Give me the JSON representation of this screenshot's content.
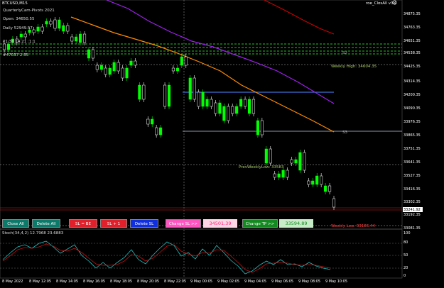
{
  "window": {
    "symbol_title": "BTCUSD,M15",
    "ea_label": "roe_ClosAll v3d",
    "smiley": "☺"
  },
  "info_panel": {
    "line1": "QuarterlyCam-Pivots 2021",
    "open": "Open: 34650.55",
    "line3": "Daily 52949.57",
    "line4": "P1:31 14:21 :1:1",
    "line5": "#47037 2:55"
  },
  "price_axis": {
    "ticks": [
      "34875.35",
      "34763.35",
      "34651.35",
      "34538.35",
      "34425.35",
      "34314.35",
      "34200.35",
      "34090.35",
      "33976.35",
      "33865.35",
      "33751.35",
      "33641.35",
      "33527.35",
      "33416.35",
      "33302.35",
      "33192.35",
      "33081.35"
    ],
    "current_price": "33241.92"
  },
  "level_labels": {
    "s2": "S2",
    "s3": "S3",
    "weekly_high": "Weekly High: 34604.35",
    "prev_weekly": "PrevWeeklyLow: 33583",
    "weekly_low": "Weekly Low: 33186.44"
  },
  "buttons": {
    "close_all": "Close All",
    "delete_all": "Delete All",
    "sl_be": "SL = BE",
    "sl_plus": "SL + 1",
    "delete_sl": "Delete SL",
    "change_sl": "Change SL >>",
    "sl_value": "34501.39",
    "change_tp": "Change TP >>",
    "tp_value": "33594.89"
  },
  "stoch": {
    "label": "Stoch(34,4,2) 12.7968 23.6883",
    "ticks": [
      "100",
      "80",
      "50",
      "20",
      "0"
    ]
  },
  "time_axis": [
    "8 May 2022",
    "8 May 12:05",
    "8 May 14:05",
    "8 May 16:05",
    "8 May 18:05",
    "8 May 20:05",
    "8 May 22:05",
    "9 May 00:05",
    "9 May 02:05",
    "9 May 04:05",
    "9 May 06:05",
    "9 May 08:05",
    "9 May 10:05"
  ],
  "colors": {
    "bull": "#00ff00",
    "bear": "#ffffff",
    "ma_orange": "#ff8c00",
    "ma_purple": "#a020f0",
    "ma_red": "#cc0000",
    "blue_line": "#3d6fd8",
    "stoch_main": "#20c0c0",
    "stoch_signal": "#cc1010"
  }
}
